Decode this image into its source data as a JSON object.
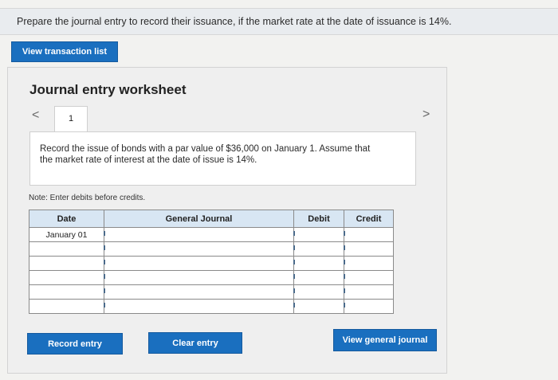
{
  "question": {
    "text": "Prepare the journal entry to record their issuance, if the market rate at the date of issuance is 14%."
  },
  "top_button": {
    "label": "View transaction list"
  },
  "worksheet": {
    "title": "Journal entry worksheet",
    "tab_number": "1",
    "nav_prev": "<",
    "nav_next": ">",
    "description": "Record the issue of bonds with a par value of $36,000 on January 1. Assume that the market rate of interest at the date of issue is 14%.",
    "note": "Note: Enter debits before credits.",
    "table": {
      "headers": [
        "Date",
        "General Journal",
        "Debit",
        "Credit"
      ],
      "rows": [
        [
          "January 01",
          "",
          "",
          ""
        ],
        [
          "",
          "",
          "",
          ""
        ],
        [
          "",
          "",
          "",
          ""
        ],
        [
          "",
          "",
          "",
          ""
        ],
        [
          "",
          "",
          "",
          ""
        ],
        [
          "",
          "",
          "",
          ""
        ]
      ]
    },
    "buttons": {
      "record": "Record entry",
      "clear": "Clear entry",
      "view_general": "View general journal"
    }
  }
}
